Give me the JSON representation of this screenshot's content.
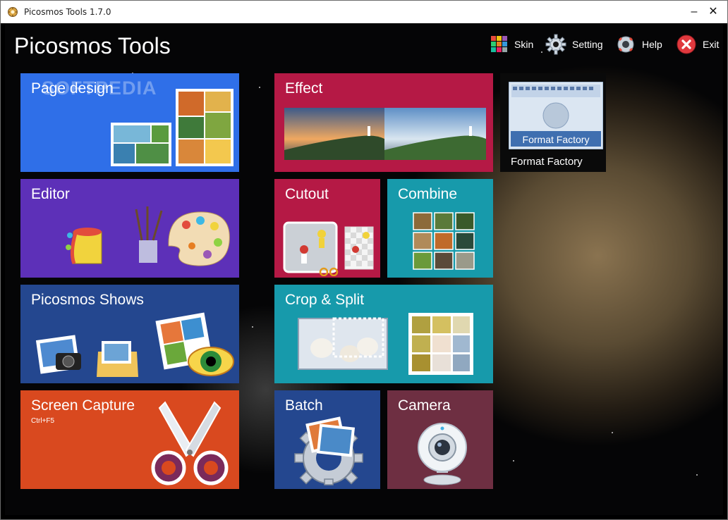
{
  "window": {
    "title": "Picosmos Tools 1.7.0"
  },
  "header": {
    "app_title": "Picosmos Tools"
  },
  "toolbar": {
    "skin": "Skin",
    "setting": "Setting",
    "help": "Help",
    "exit": "Exit"
  },
  "tiles": {
    "page_design": "Page design",
    "editor": "Editor",
    "shows": "Picosmos Shows",
    "screen_capture": "Screen Capture",
    "screen_capture_shortcut": "Ctrl+F5",
    "effect": "Effect",
    "cutout": "Cutout",
    "combine": "Combine",
    "crop_split": "Crop & Split",
    "batch": "Batch",
    "camera": "Camera",
    "format_factory": "Format Factory",
    "format_factory_logo": "Format Factory"
  },
  "watermark": "SOFTPEDIA",
  "colors": {
    "page_design": "#2f6fe8",
    "editor": "#5d30b8",
    "shows": "#24478f",
    "screen_capture": "#d9491f",
    "effect": "#b51945",
    "cutout": "#b51945",
    "combine": "#179aab",
    "crop_split": "#179aab",
    "batch": "#24478f",
    "camera": "#6e2f42"
  },
  "icons": [
    "app-icon",
    "skin-icon",
    "gear-icon",
    "help-icon",
    "exit-icon",
    "collage-icon",
    "paint-palette-icon",
    "photo-gallery-icon",
    "scissors-icon",
    "landscape-icon",
    "cutout-icon",
    "image-grid-icon",
    "crop-icon",
    "batch-gear-icon",
    "webcam-icon",
    "format-factory-icon"
  ]
}
